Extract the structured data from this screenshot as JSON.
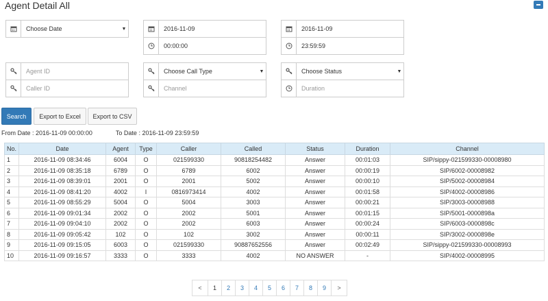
{
  "page": {
    "title": "Agent Detail All"
  },
  "filters": {
    "date_select": "Choose Date",
    "start_date": "2016-11-09",
    "start_time": "00:00:00",
    "end_date": "2016-11-09",
    "end_time": "23:59:59",
    "agent_id_placeholder": "Agent ID",
    "call_type": "Choose Call Type",
    "status": "Choose Status",
    "caller_id_placeholder": "Caller ID",
    "channel_placeholder": "Channel",
    "duration_placeholder": "Duration"
  },
  "actions": {
    "search": "Search",
    "export_excel": "Export to Excel",
    "export_csv": "Export to CSV"
  },
  "range": {
    "from": "From Date : 2016-11-09 00:00:00",
    "to": "To Date : 2016-11-09 23:59:59"
  },
  "table": {
    "columns": [
      "No.",
      "Date",
      "Agent",
      "Type",
      "Caller",
      "Called",
      "Status",
      "Duration",
      "Channel"
    ],
    "rows": [
      [
        "1",
        "2016-11-09 08:34:46",
        "6004",
        "O",
        "021599330",
        "90818254482",
        "Answer",
        "00:01:03",
        "SIP/sippy-021599330-00008980"
      ],
      [
        "2",
        "2016-11-09 08:35:18",
        "6789",
        "O",
        "6789",
        "6002",
        "Answer",
        "00:00:19",
        "SIP/6002-00008982"
      ],
      [
        "3",
        "2016-11-09 08:39:01",
        "2001",
        "O",
        "2001",
        "5002",
        "Answer",
        "00:00:10",
        "SIP/5002-00008984"
      ],
      [
        "4",
        "2016-11-09 08:41:20",
        "4002",
        "I",
        "0816973414",
        "4002",
        "Answer",
        "00:01:58",
        "SIP/4002-00008986"
      ],
      [
        "5",
        "2016-11-09 08:55:29",
        "5004",
        "O",
        "5004",
        "3003",
        "Answer",
        "00:00:21",
        "SIP/3003-00008988"
      ],
      [
        "6",
        "2016-11-09 09:01:34",
        "2002",
        "O",
        "2002",
        "5001",
        "Answer",
        "00:01:15",
        "SIP/5001-0000898a"
      ],
      [
        "7",
        "2016-11-09 09:04:10",
        "2002",
        "O",
        "2002",
        "6003",
        "Answer",
        "00:00:24",
        "SIP/6003-0000898c"
      ],
      [
        "8",
        "2016-11-09 09:05:42",
        "102",
        "O",
        "102",
        "3002",
        "Answer",
        "00:00:11",
        "SIP/3002-0000898e"
      ],
      [
        "9",
        "2016-11-09 09:15:05",
        "6003",
        "O",
        "021599330",
        "90887652556",
        "Answer",
        "00:02:49",
        "SIP/sippy-021599330-00008993"
      ],
      [
        "10",
        "2016-11-09 09:16:57",
        "3333",
        "O",
        "3333",
        "4002",
        "NO ANSWER",
        "-",
        "SIP/4002-00008995"
      ]
    ]
  },
  "pagination": {
    "prev": "<",
    "pages": [
      "1",
      "2",
      "3",
      "4",
      "5",
      "6",
      "7",
      "8",
      "9"
    ],
    "next": ">",
    "current": "1"
  },
  "icons": {
    "calendar": "calendar-icon",
    "clock": "clock-icon",
    "key": "key-icon",
    "minus": "minus-icon"
  },
  "colors": {
    "primary": "#337ab7",
    "table_header": "#d9ebf7"
  }
}
